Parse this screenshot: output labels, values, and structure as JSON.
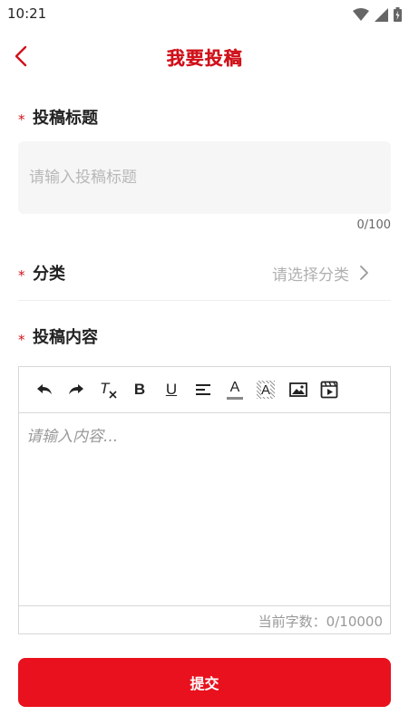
{
  "status_bar": {
    "time": "10:21"
  },
  "header": {
    "title": "我要投稿"
  },
  "title_field": {
    "label": "投稿标题",
    "placeholder": "请输入投稿标题",
    "counter": "0/100"
  },
  "category_field": {
    "label": "分类",
    "placeholder": "请选择分类"
  },
  "content_field": {
    "label": "投稿内容",
    "placeholder": "请输入内容...",
    "counter": "当前字数：0/10000"
  },
  "required_mark": "*",
  "submit_label": "提交",
  "toolbar": {
    "items": [
      "undo-icon",
      "redo-icon",
      "clear-format-icon",
      "bold-icon",
      "underline-icon",
      "align-icon",
      "font-color-icon",
      "highlight-icon",
      "image-icon",
      "video-icon"
    ],
    "bold_label": "B",
    "underline_label": "U",
    "clear_format_label": "T",
    "font_color_label": "A",
    "highlight_label": "A"
  },
  "colors": {
    "accent": "#e8111d",
    "title_red": "#d0121b"
  }
}
